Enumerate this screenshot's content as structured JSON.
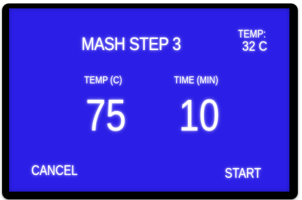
{
  "screen": {
    "title": "MASH STEP 3",
    "current_temp_label": "TEMP:",
    "current_temp_value": "32 C",
    "temp_label": "TEMP (C)",
    "time_label": "TIME (MIN)",
    "temp_value": "75",
    "time_value": "10",
    "cancel_label": "CANCEL",
    "start_label": "START"
  },
  "colors": {
    "screen_background": "#2b1ee6",
    "bezel": "#000000",
    "text": "#ffffff"
  }
}
